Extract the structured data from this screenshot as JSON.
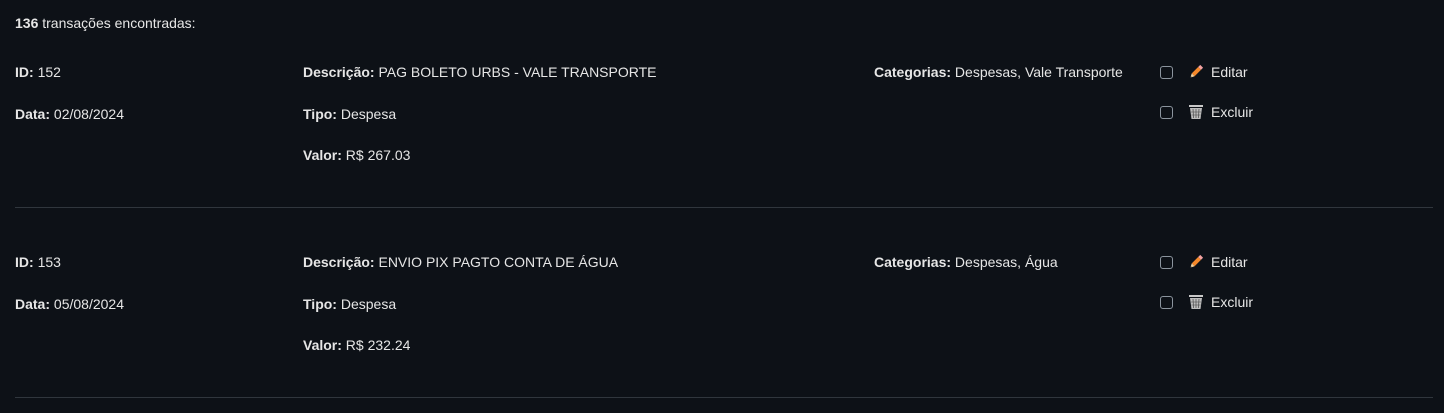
{
  "summary": {
    "count": "136",
    "text": " transações encontradas:"
  },
  "labels": {
    "id": "ID:",
    "data": "Data:",
    "descricao": "Descrição:",
    "tipo": "Tipo:",
    "valor": "Valor:",
    "categorias": "Categorias:",
    "editar": "Editar",
    "excluir": "Excluir"
  },
  "transactions": [
    {
      "id": "152",
      "data": "02/08/2024",
      "descricao": "PAG BOLETO URBS - VALE TRANSPORTE",
      "tipo": "Despesa",
      "valor": "R$ 267.03",
      "categorias": "Despesas, Vale Transporte"
    },
    {
      "id": "153",
      "data": "05/08/2024",
      "descricao": "ENVIO PIX PAGTO CONTA DE ÁGUA",
      "tipo": "Despesa",
      "valor": "R$ 232.24",
      "categorias": "Despesas, Água"
    }
  ],
  "icons": {
    "edit": "pencil-icon",
    "delete": "wastebasket-icon"
  }
}
